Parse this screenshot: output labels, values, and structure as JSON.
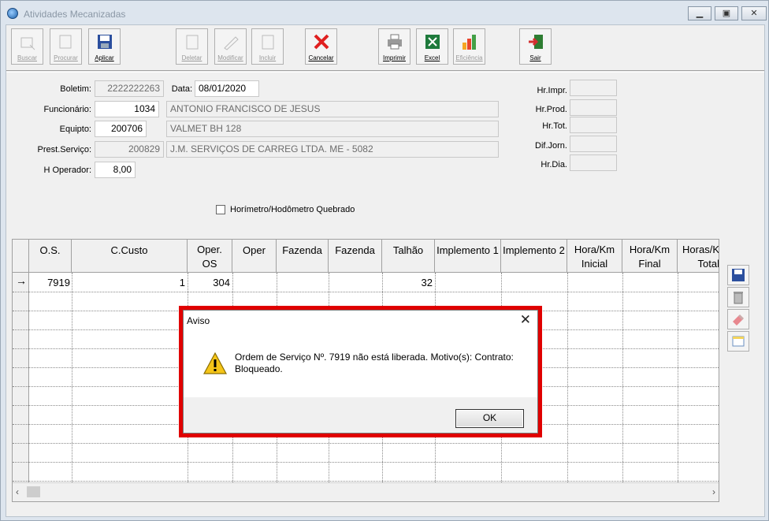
{
  "window": {
    "title": "Atividades Mecanizadas"
  },
  "toolbar": {
    "buttons": [
      {
        "label": "Buscar",
        "enabled": false
      },
      {
        "label": "Procurar",
        "enabled": false
      },
      {
        "label": "Aplicar",
        "enabled": true
      },
      {
        "label": "Deletar",
        "enabled": false
      },
      {
        "label": "Modificar",
        "enabled": false
      },
      {
        "label": "Incluir",
        "enabled": false
      },
      {
        "label": "Cancelar",
        "enabled": true
      },
      {
        "label": "Imprimir",
        "enabled": true
      },
      {
        "label": "Excel",
        "enabled": true
      },
      {
        "label": "Eficiência",
        "enabled": false
      },
      {
        "label": "Sair",
        "enabled": true
      }
    ]
  },
  "form": {
    "boletim_label": "Boletim:",
    "boletim_value": "2222222263",
    "data_label": "Data:",
    "data_value": "08/01/2020",
    "funcionario_label": "Funcionário:",
    "funcionario_code": "1034",
    "funcionario_name": "ANTONIO FRANCISCO DE JESUS",
    "equipto_label": "Equipto:",
    "equipto_code": "200706",
    "equipto_name": "VALMET BH 128",
    "prest_label": "Prest.Serviço:",
    "prest_code": "200829",
    "prest_name": "J.M. SERVIÇOS DE CARREG LTDA.  ME - 5082",
    "hoperador_label": "H Operador:",
    "hoperador_value": "8,00",
    "hr_impr_label": "Hr.Impr.",
    "hr_prod_label": "Hr.Prod.",
    "hr_tot_label": "Hr.Tot.",
    "dif_jorn_label": "Dif.Jorn.",
    "hr_dia_label": "Hr.Dia.",
    "horimetro_label": "Horímetro/Hodômetro Quebrado"
  },
  "grid": {
    "headers": [
      "O.S.",
      "C.Custo",
      "Oper.\nOS",
      "Oper",
      "Fazenda",
      "Fazenda",
      "Talhão",
      "Implemento 1",
      "Implemento 2",
      "Hora/Km\nInicial",
      "Hora/Km\nFinal",
      "Horas/K\nTotal"
    ],
    "row1": {
      "os": "7919",
      "ccusto": "1",
      "oper_os": "304",
      "talhao": "32"
    }
  },
  "dialog": {
    "title": "Aviso",
    "message": "Ordem de Serviço Nº. 7919 não está liberada. Motivo(s): Contrato: Bloqueado.",
    "ok_label": "OK",
    "close_glyph": "✕"
  },
  "colors": {
    "highlight": "#e00000",
    "window_bg": "#dde5ee",
    "panel_bg": "#f0f0f0"
  }
}
